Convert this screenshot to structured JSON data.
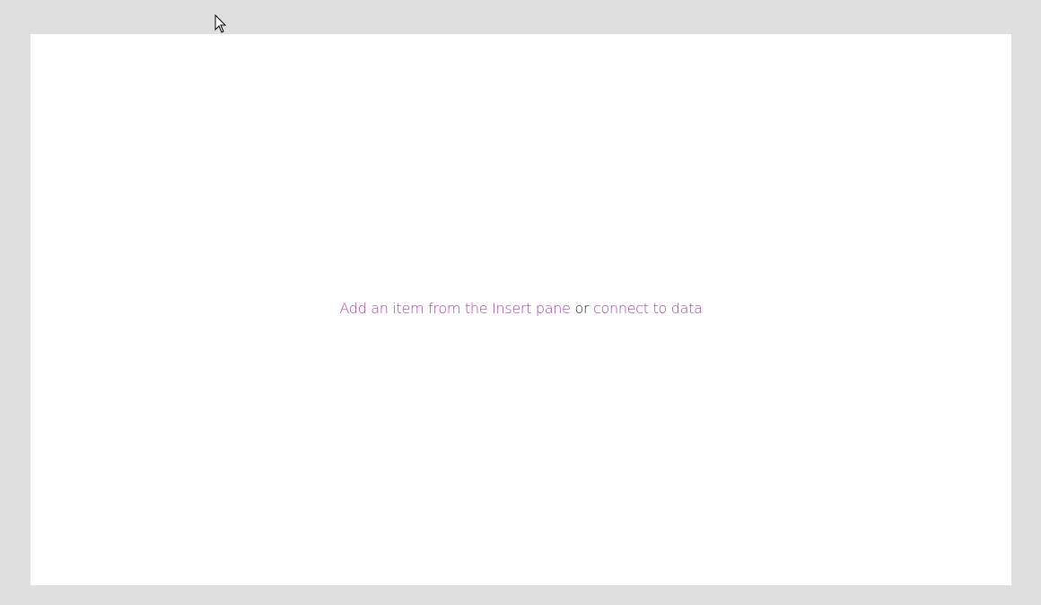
{
  "canvas": {
    "insert_link": "Add an item from the Insert pane",
    "separator": "or",
    "connect_link": "connect to data",
    "link_color": "#a349a4"
  },
  "cursor": {
    "icon": "arrow-pointer-icon"
  }
}
